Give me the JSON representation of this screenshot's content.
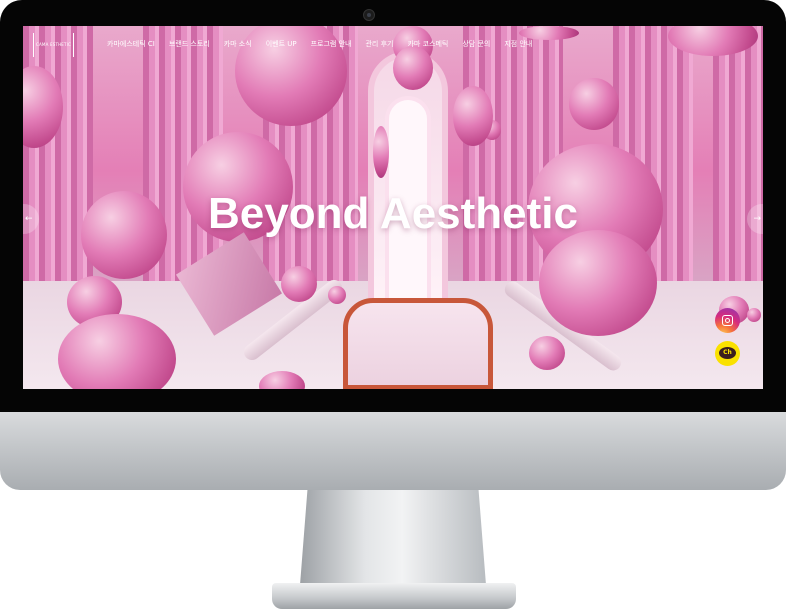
{
  "logo": {
    "text": "CAMA ESTHETIC"
  },
  "nav": {
    "items": [
      {
        "label": "카마에스테틱 CI"
      },
      {
        "label": "브랜드 스토리"
      },
      {
        "label": "카마 소식"
      },
      {
        "label": "이벤트 UP"
      },
      {
        "label": "프로그램 안내"
      },
      {
        "label": "관리 후기"
      },
      {
        "label": "카마 코스메틱"
      },
      {
        "label": "상담 문의"
      },
      {
        "label": "지점 안내"
      }
    ]
  },
  "hero": {
    "headline": "Beyond Aesthetic",
    "prev_arrow": "←",
    "next_arrow": "→"
  },
  "social": {
    "instagram_icon": "instagram-icon",
    "kakao_label": "Ch"
  },
  "colors": {
    "monitor_bezel": "#050505",
    "hero_pink": "#e47fb6",
    "kakao_yellow": "#fae100",
    "runway_trim": "#c8573a"
  }
}
